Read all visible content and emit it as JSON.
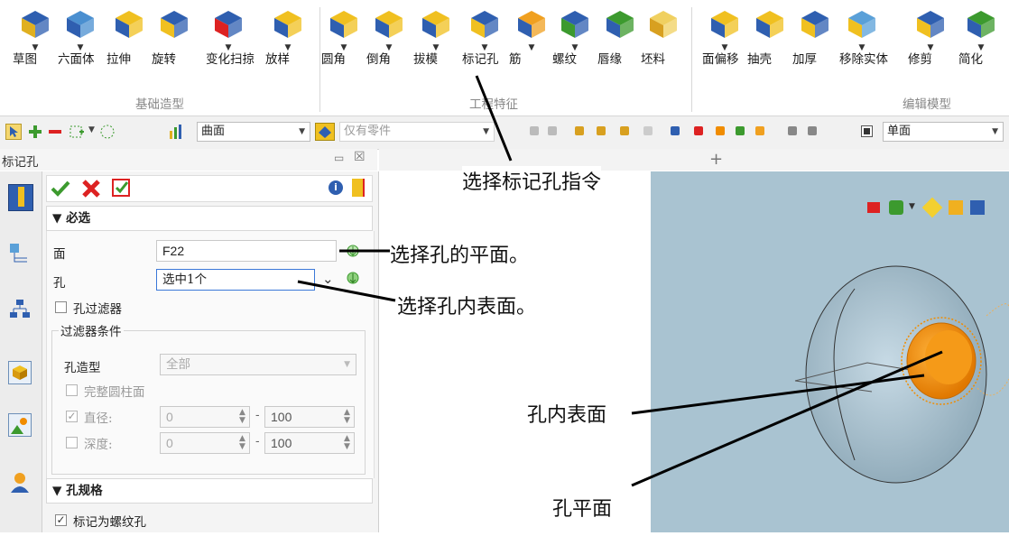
{
  "ribbon": {
    "buttons": [
      {
        "label": "草图",
        "icon": "sketch-icon",
        "drop": true
      },
      {
        "label": "六面体",
        "icon": "hexahedron-icon",
        "drop": true
      },
      {
        "label": "拉伸",
        "icon": "extrude-icon",
        "drop": false
      },
      {
        "label": "旋转",
        "icon": "revolve-icon",
        "drop": false
      },
      {
        "label": "变化扫掠",
        "icon": "variable-sweep-icon",
        "drop": true
      },
      {
        "label": "放样",
        "icon": "loft-icon",
        "drop": true
      },
      {
        "label": "圆角",
        "icon": "fillet-icon",
        "drop": true
      },
      {
        "label": "倒角",
        "icon": "chamfer-icon",
        "drop": true
      },
      {
        "label": "拔模",
        "icon": "draft-icon",
        "drop": true
      },
      {
        "label": "标记孔",
        "icon": "mark-hole-icon",
        "drop": true
      },
      {
        "label": "筋",
        "icon": "rib-icon",
        "drop": true
      },
      {
        "label": "螺纹",
        "icon": "thread-icon",
        "drop": true
      },
      {
        "label": "唇缘",
        "icon": "lip-icon",
        "drop": false
      },
      {
        "label": "坯料",
        "icon": "blank-icon",
        "drop": false
      },
      {
        "label": "面偏移",
        "icon": "face-offset-icon",
        "drop": true
      },
      {
        "label": "抽壳",
        "icon": "shell-icon",
        "drop": false
      },
      {
        "label": "加厚",
        "icon": "thicken-icon",
        "drop": false
      },
      {
        "label": "移除实体",
        "icon": "remove-solid-icon",
        "drop": true
      },
      {
        "label": "修剪",
        "icon": "trim-icon",
        "drop": true
      },
      {
        "label": "简化",
        "icon": "simplify-icon",
        "drop": true
      }
    ],
    "groups": [
      "基础造型",
      "工程特征",
      "编辑模型"
    ]
  },
  "toolbar": {
    "filter_select": "曲面",
    "scope_select": "仅有零件",
    "view_select": "单面"
  },
  "panel": {
    "title": "标记孔",
    "section_required": "▼ 必选",
    "face_label": "面",
    "face_value": "F22",
    "hole_label": "孔",
    "hole_value": "选中1个",
    "hole_filter_label": "孔过滤器",
    "filter_group_label": "过滤器条件",
    "hole_type_label": "孔造型",
    "hole_type_value": "全部",
    "full_cylinder_label": "完整圆柱面",
    "diameter_label": "直径:",
    "diameter_min": "0",
    "diameter_max": "100",
    "depth_label": "深度:",
    "depth_min": "0",
    "depth_max": "100",
    "section_spec": "▼ 孔规格",
    "mark_thread_label": "标记为螺纹孔",
    "dash": "-",
    "ok_icon": "check-icon",
    "cancel_icon": "close-icon",
    "apply_icon": "apply-icon",
    "info_icon": "info-icon",
    "help_icon": "help-icon"
  },
  "tabs": {
    "add": "+"
  },
  "annotations": {
    "select_command": "选择标记孔指令",
    "select_face": "选择孔的平面。",
    "select_inner": "选择孔内表面。",
    "inner_surface": "孔内表面",
    "hole_plane": "孔平面"
  },
  "colors": {
    "accent": "#3b78d8",
    "hole_orange": "#f08c00",
    "viewport_bg": "#a9c3d1"
  }
}
